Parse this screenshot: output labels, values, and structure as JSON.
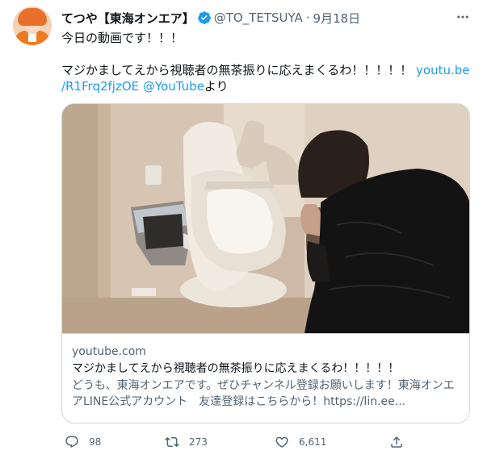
{
  "tweet": {
    "display_name": "てつや【東海オンエア】",
    "handle": "@TO_TETSUYA",
    "separator": "·",
    "date": "9月18日",
    "text_line1": "今日の動画です！！！",
    "text_line2": "マジかましてえから視聴者の無茶振りに応えまくるわ！！！！！",
    "link_part1": "youtu.be",
    "link_part2": "/R1Frq2fjzOE",
    "mention": "@YouTube",
    "trailing": "より"
  },
  "card": {
    "domain": "youtube.com",
    "title": "マジかましてえから視聴者の無茶振りに応えまくるわ！！！！！",
    "description": "どうも、東海オンエアです。ぜひチャンネル登録お願いします！東海オンエアLINE公式アカウント　友達登録はこちらから！https://lin.ee..."
  },
  "actions": {
    "reply_count": "98",
    "retweet_count": "273",
    "like_count": "6,611"
  },
  "icons": {
    "verified": "verified-badge-icon",
    "more": "more-icon",
    "reply": "reply-icon",
    "retweet": "retweet-icon",
    "like": "heart-icon",
    "share": "share-icon"
  },
  "colors": {
    "link": "#1d9bf0",
    "secondary_text": "#536471",
    "border": "#cfd9de"
  }
}
